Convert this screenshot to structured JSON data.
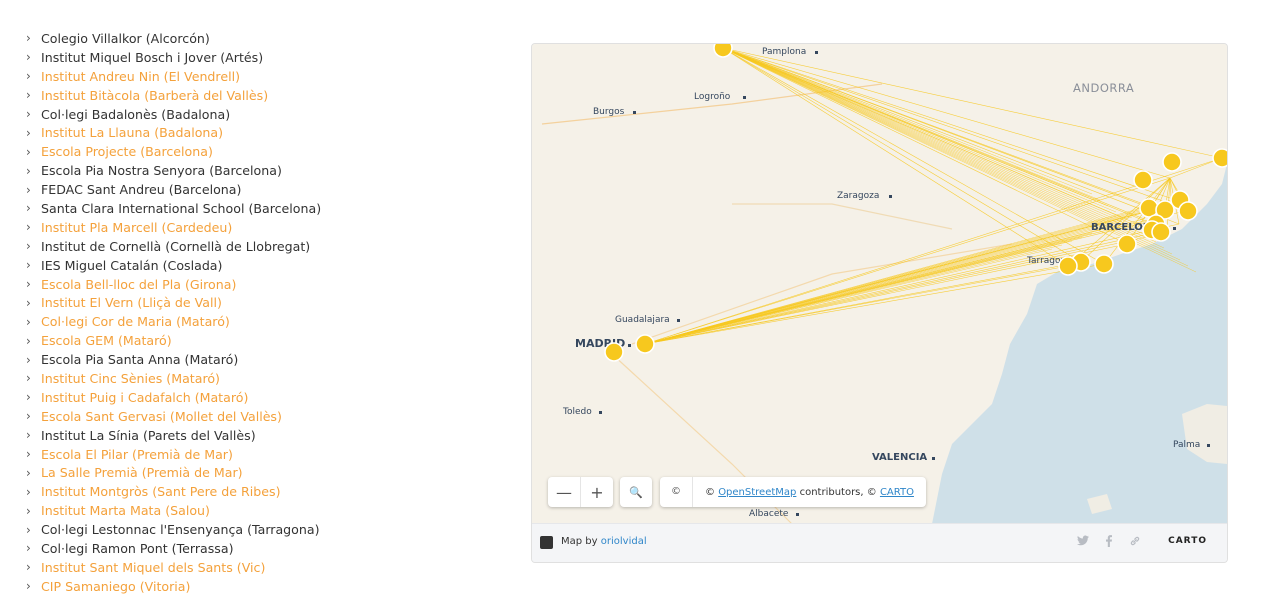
{
  "schools": [
    {
      "label": "Colegio Villalkor (Alcorcón)",
      "link": false
    },
    {
      "label": "Institut Miquel Bosch i Jover (Artés)",
      "link": false
    },
    {
      "label": "Institut Andreu Nin (El Vendrell)",
      "link": true
    },
    {
      "label": "Institut Bitàcola (Barberà del Vallès)",
      "link": true
    },
    {
      "label": "Col·legi Badalonès (Badalona)",
      "link": false
    },
    {
      "label": "Institut La Llauna (Badalona)",
      "link": true
    },
    {
      "label": "Escola Projecte (Barcelona)",
      "link": true
    },
    {
      "label": "Escola Pia Nostra Senyora (Barcelona)",
      "link": false
    },
    {
      "label": "FEDAC Sant Andreu (Barcelona)",
      "link": false
    },
    {
      "label": "Santa Clara International School (Barcelona)",
      "link": false
    },
    {
      "label": "Institut Pla Marcell (Cardedeu)",
      "link": true
    },
    {
      "label": "Institut de Cornellà (Cornellà de Llobregat)",
      "link": false
    },
    {
      "label": "IES Miguel Catalán (Coslada)",
      "link": false
    },
    {
      "label": "Escola Bell-lloc del Pla (Girona)",
      "link": true
    },
    {
      "label": "Institut El Vern (Lliçà de Vall)",
      "link": true
    },
    {
      "label": "Col·legi Cor de Maria (Mataró)",
      "link": true
    },
    {
      "label": "Escola GEM (Mataró)",
      "link": true
    },
    {
      "label": "Escola Pia Santa Anna (Mataró)",
      "link": false
    },
    {
      "label": "Institut Cinc Sènies (Mataró)",
      "link": true
    },
    {
      "label": "Institut Puig i Cadafalch (Mataró)",
      "link": true
    },
    {
      "label": "Escola Sant Gervasi (Mollet del Vallès)",
      "link": true
    },
    {
      "label": "Institut La Sínia (Parets del Vallès)",
      "link": false
    },
    {
      "label": "Escola El Pilar (Premià de Mar)",
      "link": true
    },
    {
      "label": "La Salle Premià (Premià de Mar)",
      "link": true
    },
    {
      "label": "Institut Montgròs (Sant Pere de Ribes)",
      "link": true
    },
    {
      "label": "Institut Marta Mata (Salou)",
      "link": true
    },
    {
      "label": "Col·legi Lestonnac l'Ensenyança (Tarragona)",
      "link": false
    },
    {
      "label": "Col·legi Ramon Pont (Terrassa)",
      "link": false
    },
    {
      "label": "Institut Sant Miquel dels Sants (Vic)",
      "link": true
    },
    {
      "label": "CIP Samaniego (Vitoria)",
      "link": true
    }
  ],
  "map": {
    "cities": [
      "Pamplona",
      "Logroño",
      "Burgos",
      "Zaragoza",
      "BARCELONA",
      "Tarragona",
      "Guadalajara",
      "MADRID",
      "Toledo",
      "VALENCIA",
      "Albacete",
      "Palma"
    ],
    "region_label": "ANDORRA",
    "marker_color": "#f7c81e",
    "line_color": "#f7c81e",
    "sea_color": "#cfe0e8",
    "land_color": "#f5f1e8",
    "controls": {
      "zoom_out_icon": "minus-icon",
      "zoom_out": "—",
      "zoom_in_icon": "plus-icon",
      "zoom_in": "+",
      "search_icon": "search-icon",
      "search": "🔍",
      "attribution_icon": "copyright-icon",
      "attribution_glyph": "©"
    },
    "attribution": {
      "prefix": "©",
      "osm_link": "OpenStreetMap",
      "middle": "contributors, ©",
      "carto_link": "CARTO"
    },
    "footer": {
      "map_by": "Map by",
      "author": "oriolvidal",
      "twitter_icon": "twitter-icon",
      "facebook_icon": "facebook-icon",
      "link_icon": "link-icon",
      "logo": "CARTO"
    }
  }
}
